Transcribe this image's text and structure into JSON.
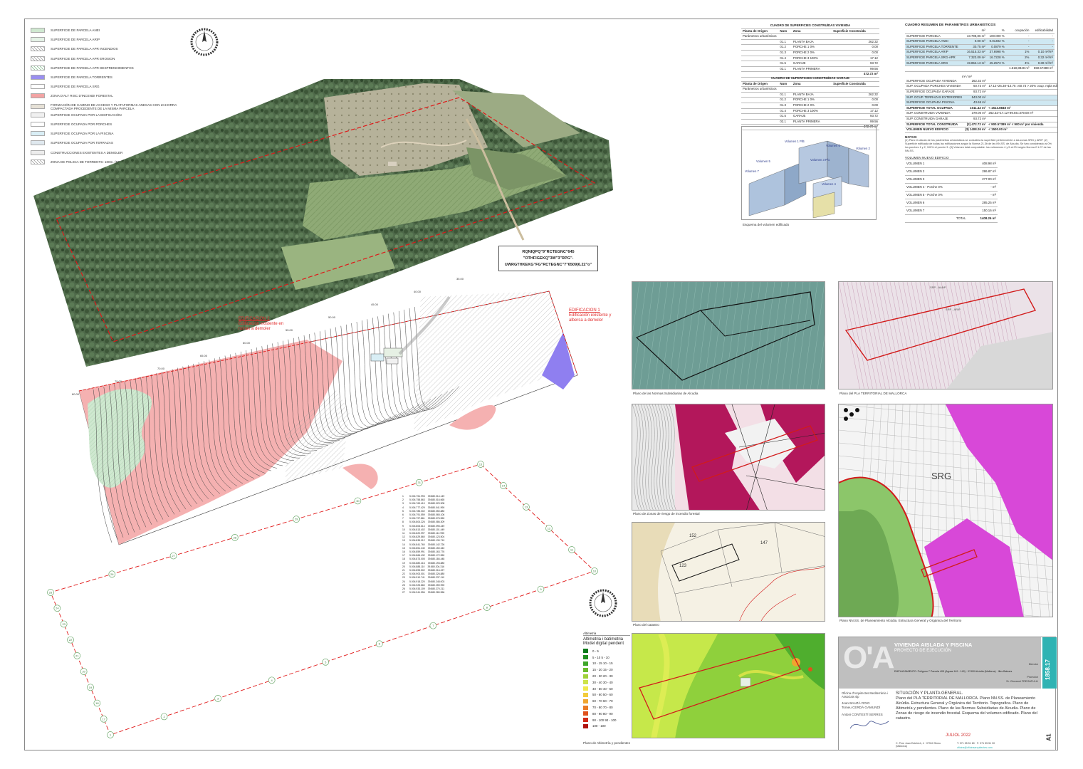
{
  "legend": [
    {
      "label": "SUPERFICIE DE PARCELA ANEI",
      "color": "#cfe8d0",
      "pattern": "solid"
    },
    {
      "label": "SUPERFICIE DE PARCELA ARIP",
      "color": "#e4f2e6",
      "pattern": "solid"
    },
    {
      "label": "SUPERFICIE DE PARCELA APR INCENDIOS",
      "color": "#ffffff",
      "pattern": "hatch"
    },
    {
      "label": "SUPERFICIE DE PARCELA APR EROSION",
      "color": "#ffffff",
      "pattern": "hatch"
    },
    {
      "label": "SUPERFICIE DE PARCELA APR DESPRENDIMIENTOS",
      "color": "#ffffff",
      "pattern": "hatch-green"
    },
    {
      "label": "SUPERFICIE DE PARCELA TORRENTES",
      "color": "#9a8ff0",
      "pattern": "solid"
    },
    {
      "label": "SUPERFICIE DE PARCELA SRG",
      "color": "#ffffff",
      "pattern": "solid"
    },
    {
      "label": "ZONA D'ALT RISC D'INCENDI FORESTAL",
      "color": "#f3a3a3",
      "pattern": "solid"
    },
    {
      "label": "FORMACIÓN DE CAMINO DE ACCESO Y PLATAFORMAS ANEXAS CON ZAHORRA COMPACTADA PROCEDENTE DE LA MISMA PARCELA",
      "color": "#e6e1d6",
      "pattern": "solid"
    },
    {
      "label": "SUPERFICIE OCUPADA POR LA EDIFICACIÓN",
      "color": "#f0f0f0",
      "pattern": "solid"
    },
    {
      "label": "SUPERFICIE OCUPADA POR PORCHES",
      "color": "#ffffff",
      "pattern": "solid"
    },
    {
      "label": "SUPERFICIE OCUPADA POR LA PISCINA",
      "color": "#d9eef5",
      "pattern": "solid"
    },
    {
      "label": "SUPERFICIE OCUPADA POR TERRAZAS",
      "color": "#dfe8ee",
      "pattern": "solid"
    },
    {
      "label": "CONSTRUCCIONES EXISTENTES A DEMOLER",
      "color": "#ececec",
      "pattern": "solid"
    },
    {
      "label": "ZONA DE POLICIA DE TORRENTS: 100m. (RD 849/1986 y RD 1/2001)",
      "color": "#ffffff",
      "pattern": "hatch"
    }
  ],
  "parcel_id": {
    "line1": "RQNIQPQ\"9\"RCTEGNC\"645",
    "line2": "\"OTHFIGEKQ\"3W\"3\"RPG\"-",
    "line3": "UWRGTHKEKG\"FG\"RCTEGNC\"7\"6509(6.22\"o\""
  },
  "plan_annotations": {
    "edificacion1_title": "EDIFICACION 1",
    "edificacion1_text": "Edificación existente y alberca a demoler",
    "edificacion2_title": "EDIFICACION 2",
    "edificacion2_text": "Edificación existente en ruinas a demoler",
    "contour_labels": [
      "80.00",
      "75.00",
      "70.00",
      "65.00",
      "60.00",
      "55.00",
      "50.00",
      "45.00",
      "40.00",
      "35.00"
    ]
  },
  "vivienda_table": {
    "title": "CUADRO DE SUPERFICIES CONSTRUÍDAS VIVIENDA",
    "headers": [
      "Planta de Origen",
      "Num",
      "Zona",
      "Superficie Construida"
    ],
    "subheader": "Parámetros urbanísticos",
    "rows": [
      [
        "",
        "01.1",
        "PLANTA BAJA",
        "262.32"
      ],
      [
        "",
        "01.2",
        "PORCHE 1 0%",
        "0.00"
      ],
      [
        "",
        "01.3",
        "PORCHE 2 0%",
        "0.00"
      ],
      [
        "",
        "01.4",
        "PORCHE 3 100%",
        "17.12"
      ],
      [
        "",
        "01.5",
        "GARAJE",
        "93.72"
      ],
      [
        "",
        "02.1",
        "PLANTA PRIMERA",
        "99.56"
      ]
    ],
    "total": "472.72 m²"
  },
  "garaje_table": {
    "title": "CUADRO DE SUPERFICIES CONSTRUÍDAS GARAJE",
    "headers": [
      "Planta de Origen",
      "Num",
      "Zona",
      "Superficie Construida"
    ],
    "subheader": "Parámetros urbanísticos",
    "rows": [
      [
        "",
        "01.1",
        "PLANTA BAJA",
        "262.32"
      ],
      [
        "",
        "01.2",
        "PORCHE 1 0%",
        "0.00"
      ],
      [
        "",
        "01.3",
        "PORCHE 2 0%",
        "0.00"
      ],
      [
        "",
        "01.4",
        "PORCHE 3 100%",
        "17.12"
      ],
      [
        "",
        "01.5",
        "GARAJE",
        "93.72"
      ],
      [
        "",
        "02.1",
        "PLANTA PRIMERA",
        "99.56"
      ]
    ],
    "total": "472.72 m²"
  },
  "volume_diagram": {
    "caption": "Esquema del volumen edificado",
    "labels": [
      "Volumen 1 P/B",
      "Volumen 6",
      "Volumen 2",
      "Volumen 5",
      "Volumen 3 P/1",
      "Volumen 7",
      "Volumen 4"
    ]
  },
  "param_table": {
    "title": "CUADRO RESUMEN DE PARAMETROS URBANISTICOS",
    "headers": [
      "",
      "m²",
      "%",
      "ocupación",
      "edificabilidad"
    ],
    "rows": [
      [
        "SUPERFICIE PARCELA",
        "43.798,86 m²",
        "100.000 %",
        "-",
        "-"
      ],
      [
        "SUPERFICIE PARCELA ANEI",
        "0.00 m²",
        "0.01492 %",
        "-",
        "-"
      ],
      [
        "SUPERFICIE PARCELA TORRENTE",
        "30.75 m²",
        "0.0879 %",
        "-",
        "-"
      ],
      [
        "SUPERFICIE PARCELA ARIP",
        "16.515.33 m²",
        "37.6998 %",
        "1%",
        "0.10 m²/m²"
      ],
      [
        "SUPERFICIE PARCELA SRG-APR",
        "7.323.09 m²",
        "16.7228 %",
        "2%",
        "0.32 m²/m²"
      ],
      [
        "SUPERFICIE PARCELA SRG",
        "19.852.13 m²",
        "45.2573 %",
        "4%",
        "0.30 m²/m²"
      ]
    ],
    "totals": [
      "1.518,8848 m²",
      "550.57389 m²"
    ],
    "ocupacion_header": "m² / m²",
    "ocupacion_rows": [
      [
        "SUPERFICIE OCUPADA VIVIENDA",
        "262.32 m²",
        ""
      ],
      [
        "SUP. OCUPADA PORCHES VIVIENDA",
        "60.73 m²",
        "17.12+26.38+14.75 =60.73 > 20% ocup. mpla edif."
      ],
      [
        "SUPERFICIE OCUPADA GARAJE",
        "93.72 m²",
        ""
      ],
      [
        "SUP. OCUP. TERRAZAS EXTERIORES",
        "543.00 m²",
        ""
      ],
      [
        "SUPERFICIE OCUPADA PISCINA",
        "43.65 m²",
        ""
      ],
      [
        "SUPERFICIE TOTAL OCUPADA",
        "1011.42 m²",
        "< 1513.8848 m²"
      ],
      [
        "SUP. CONSTRUIDA VIVIENDA",
        "379.00 m²",
        "262.32+17.12+99.56=379.00 m²"
      ],
      [
        "SUP. CONSTRUIDA GARAJE",
        "93.72 m²",
        ""
      ],
      [
        "SUPERFICIE TOTAL CONSTRUIDA",
        "(2) 472.72 m²",
        "< 900.57389 m² < 900 m² por vivienda"
      ],
      [
        "VOLUMEN NUEVO EDIFICIO",
        "(3) 1408.26 m³",
        "< 1500.00 m³"
      ]
    ],
    "notes_title": "NOTAS:",
    "notes": "(1) Para el cálculo de los parámetros urbanísticos se considera la superficie perteneciente a las zonas SRG y ARIP. (2) Superficie edificada de todas las edificaciones según la Norma 21.3b de las NN.SS. de Alcudia. Se han considerado al 0% los porches 1 y 2, 100% el porche 3. (3) Volumen total computable: los volúmenes 4 y 5 al 0% según Norma 2.1.07 de las NN.SS.",
    "volumen_title": "VOLUMEN NUEVO EDIFICIO",
    "volumen_rows": [
      [
        "VOLUMEN 1",
        "408.98 m³"
      ],
      [
        "VOLUMEN 2",
        "286.87 m³"
      ],
      [
        "VOLUMEN 3",
        "277.00 m³"
      ],
      [
        "VOLUMEN 4 - Porche 0%",
        "- m³"
      ],
      [
        "VOLUMEN 5 - Porche 0%",
        "- m³"
      ],
      [
        "VOLUMEN 6",
        "285.25 m³"
      ],
      [
        "VOLUMEN 7",
        "150.16 m³"
      ]
    ],
    "volumen_total": [
      "TOTAL",
      "1408.26 m³"
    ]
  },
  "small_maps": [
    {
      "caption": "Plano de las Normas Subsidiarias de Alcudia"
    },
    {
      "caption": "Plano del PLA TERRITORIAL DE MALLORCA"
    },
    {
      "caption": "Plano de Zonas de riesgo de incendio forestal"
    },
    {
      "caption": "Plano NN.SS. de Planeamiento Alcúdia. Estructura General y Orgánica del Territorio"
    },
    {
      "caption": "Plano del catastro"
    },
    {
      "caption": "Plano de Altimetría y pendientes"
    }
  ],
  "map_labels": {
    "srg": "SRG",
    "map2_label_1": "SRP - ARIP",
    "map2_label_2": "SRP - AANP",
    "map5_label_1": "152",
    "map5_label_2": "147",
    "map5_label_3": "123"
  },
  "altimetry_legend": {
    "header": "Altimetria",
    "title": "Altimetria i batimetria",
    "subtitle": "Model digital pendent",
    "items": [
      {
        "label": "0 - 5",
        "color": "#0b7a1a"
      },
      {
        "label": "5 - 10   5 - 10",
        "color": "#1f8f1f"
      },
      {
        "label": "10 - 15  10 - 15",
        "color": "#3fa62a"
      },
      {
        "label": "15 - 20  15 - 20",
        "color": "#6bbd2f"
      },
      {
        "label": "20 - 30  20 - 30",
        "color": "#9fd13a"
      },
      {
        "label": "30 - 40  30 - 40",
        "color": "#cde34a"
      },
      {
        "label": "40 - 50  40 - 50",
        "color": "#f0e94c"
      },
      {
        "label": "50 - 60  50 - 60",
        "color": "#f3cc3c"
      },
      {
        "label": "60 - 70  60 - 70",
        "color": "#f0a52e"
      },
      {
        "label": "70 - 80  70 - 80",
        "color": "#ea7b23"
      },
      {
        "label": "80 - 90  80 - 90",
        "color": "#e0521c"
      },
      {
        "label": "90 - 100  90 - 100",
        "color": "#d22b17"
      },
      {
        "label": "100 - 100",
        "color": "#b01410"
      }
    ]
  },
  "title_block": {
    "project_title": "VIVIENDA AISLADA Y PISCINA",
    "project_subtitle": "PROYECTO DE EJECUCIÓN",
    "project_number": "1858.17",
    "director_label": "Director",
    "address": "EMPLAZAMIENTO: Polígono 7 Parcela 405 (Aguas 149 - 149) · 07400 Alcúdia (Mallorca) · Illes Balears",
    "promotor": "Promotor",
    "promotor_name": "Sr. Giovanni FREGATULLI",
    "office": "Oficina d'Arquitectes Mediterrània i Associats slp",
    "architect1": "Joan BAUZÀ ROIG",
    "architect2": "Tomeu CERDÀ GAMUNDÍ",
    "architect3": "Antoni CONTESTÍ SERRES",
    "sheet_title": "SITUACIÓN Y PLANTA GENERAL.",
    "sheet_description": "Plano del PLA TERRITORIAL DE MALLORCA. Plano NN.SS. de Planeamiento Alcúdia. Estructura General y Orgánica del Territorio. Topografica. Plano de Altimetría y pendientes. Plano de las Normas Subsidiarias de Alcudia. Plano de Zonas de riesgo de incendio forestal. Esquema del volumen edificado. Plano del catastro.",
    "date": "JULIOL 2022",
    "sheet_number": "A1",
    "address_footer": "C. Pere Joan Estelrich, 4 · 07510 Sineu (Mallorca)",
    "phone": "T: 971 55 51 80 · F: 971 55 51 30",
    "email": "oficina@oficinaarquitectes.com",
    "logo_text": "O'A"
  },
  "coordinate_table": {
    "rows": [
      [
        "1",
        "5.004.751.993",
        "39.880.014.149"
      ],
      [
        "2",
        "5.004.758.863",
        "39.880.016.665"
      ],
      [
        "3",
        "5.004.769.410",
        "39.880.029.908"
      ],
      [
        "4",
        "5.004.777.429",
        "39.880.041.990"
      ],
      [
        "5",
        "5.004.785.002",
        "39.880.050.880"
      ],
      [
        "6",
        "5.004.791.559",
        "39.880.065.106"
      ],
      [
        "7",
        "5.004.797.861",
        "39.880.076.550"
      ],
      [
        "8",
        "5.004.804.226",
        "39.880.086.309"
      ],
      [
        "9",
        "5.004.806.614",
        "39.880.095.449"
      ],
      [
        "10",
        "5.004.813.402",
        "39.880.101.449"
      ],
      [
        "11",
        "5.004.820.997",
        "39.880.112.995"
      ],
      [
        "12",
        "5.004.829.860",
        "39.880.123.504"
      ],
      [
        "13",
        "5.004.835.012",
        "39.880.130.710"
      ],
      [
        "14",
        "5.004.841.760",
        "39.880.142.726"
      ],
      [
        "15",
        "5.004.851.240",
        "39.880.150.340"
      ],
      [
        "16",
        "5.004.859.991",
        "39.880.163.776"
      ],
      [
        "17",
        "5.004.866.432",
        "39.880.172.550"
      ],
      [
        "18",
        "5.004.873.005",
        "39.880.184.448"
      ],
      [
        "19",
        "5.004.880.416",
        "39.880.193.880"
      ],
      [
        "20",
        "5.004.888.110",
        "39.880.204.316"
      ],
      [
        "21",
        "5.004.895.502",
        "39.880.216.227"
      ],
      [
        "22",
        "5.004.903.001",
        "39.880.226.880"
      ],
      [
        "23",
        "5.004.910.741",
        "39.880.237.110"
      ],
      [
        "24",
        "5.004.918.220",
        "39.880.248.003"
      ],
      [
        "25",
        "5.004.925.860",
        "39.880.259.990"
      ],
      [
        "26",
        "5.004.933.109",
        "39.880.270.211"
      ],
      [
        "27",
        "5.004.941.556",
        "39.880.280.556"
      ]
    ]
  },
  "vertex_labels": [
    "15",
    "14",
    "13",
    "12",
    "11",
    "10",
    "9",
    "8",
    "7",
    "6",
    "5",
    "4",
    "3",
    "2",
    "1",
    "17",
    "18",
    "19",
    "20",
    "21",
    "22",
    "23",
    "24",
    "25",
    "26",
    "27",
    "28",
    "29",
    "30",
    "31"
  ]
}
